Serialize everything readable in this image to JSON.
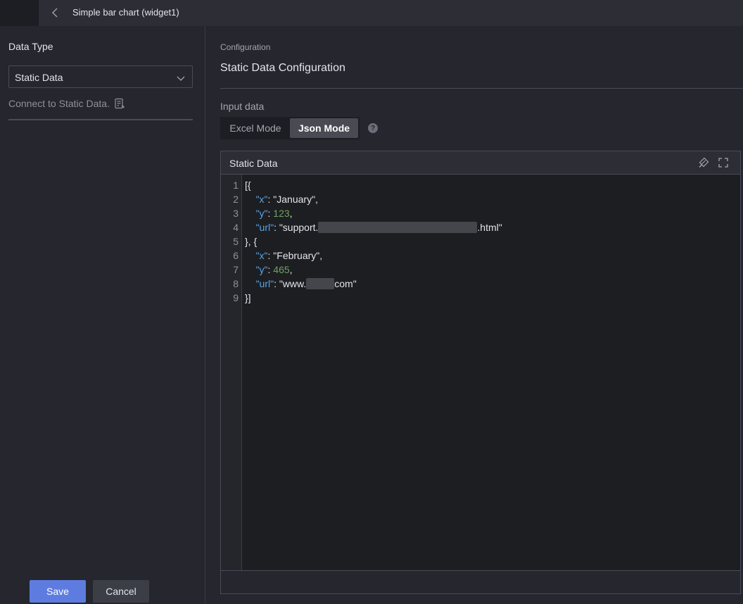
{
  "topbar": {
    "title": "Simple bar chart (widget1)"
  },
  "left": {
    "data_type_label": "Data Type",
    "data_type_value": "Static Data",
    "connect_text": "Connect to Static Data."
  },
  "right": {
    "crumb": "Configuration",
    "title": "Static Data Configuration",
    "input_label": "Input data",
    "modes": [
      "Excel Mode",
      "Json Mode"
    ],
    "active_mode": "Json Mode",
    "help": "?"
  },
  "editor": {
    "title": "Static Data",
    "line_numbers": [
      "1",
      "2",
      "3",
      "4",
      "5",
      "6",
      "7",
      "8",
      "9"
    ],
    "lines": {
      "l1": "[{",
      "l2_key": "\"x\"",
      "l2_val": ": \"January\",",
      "l3_key": "\"y\"",
      "l3_sep": ": ",
      "l3_num": "123",
      "l3_end": ",",
      "l4_key": "\"url\"",
      "l4_pre": ": \"support.",
      "l4_post": ".html\"",
      "l5": "}, {",
      "l6_key": "\"x\"",
      "l6_val": ": \"February\",",
      "l7_key": "\"y\"",
      "l7_sep": ": ",
      "l7_num": "465",
      "l7_end": ",",
      "l8_key": "\"url\"",
      "l8_pre": ": \"www.",
      "l8_post": "com\"",
      "l9": "}]"
    }
  },
  "actions": {
    "save": "Save",
    "cancel": "Cancel"
  },
  "colors": {
    "accent": "#5e7ce0",
    "json_key": "#5aa4e6",
    "json_number": "#6fa35e"
  }
}
